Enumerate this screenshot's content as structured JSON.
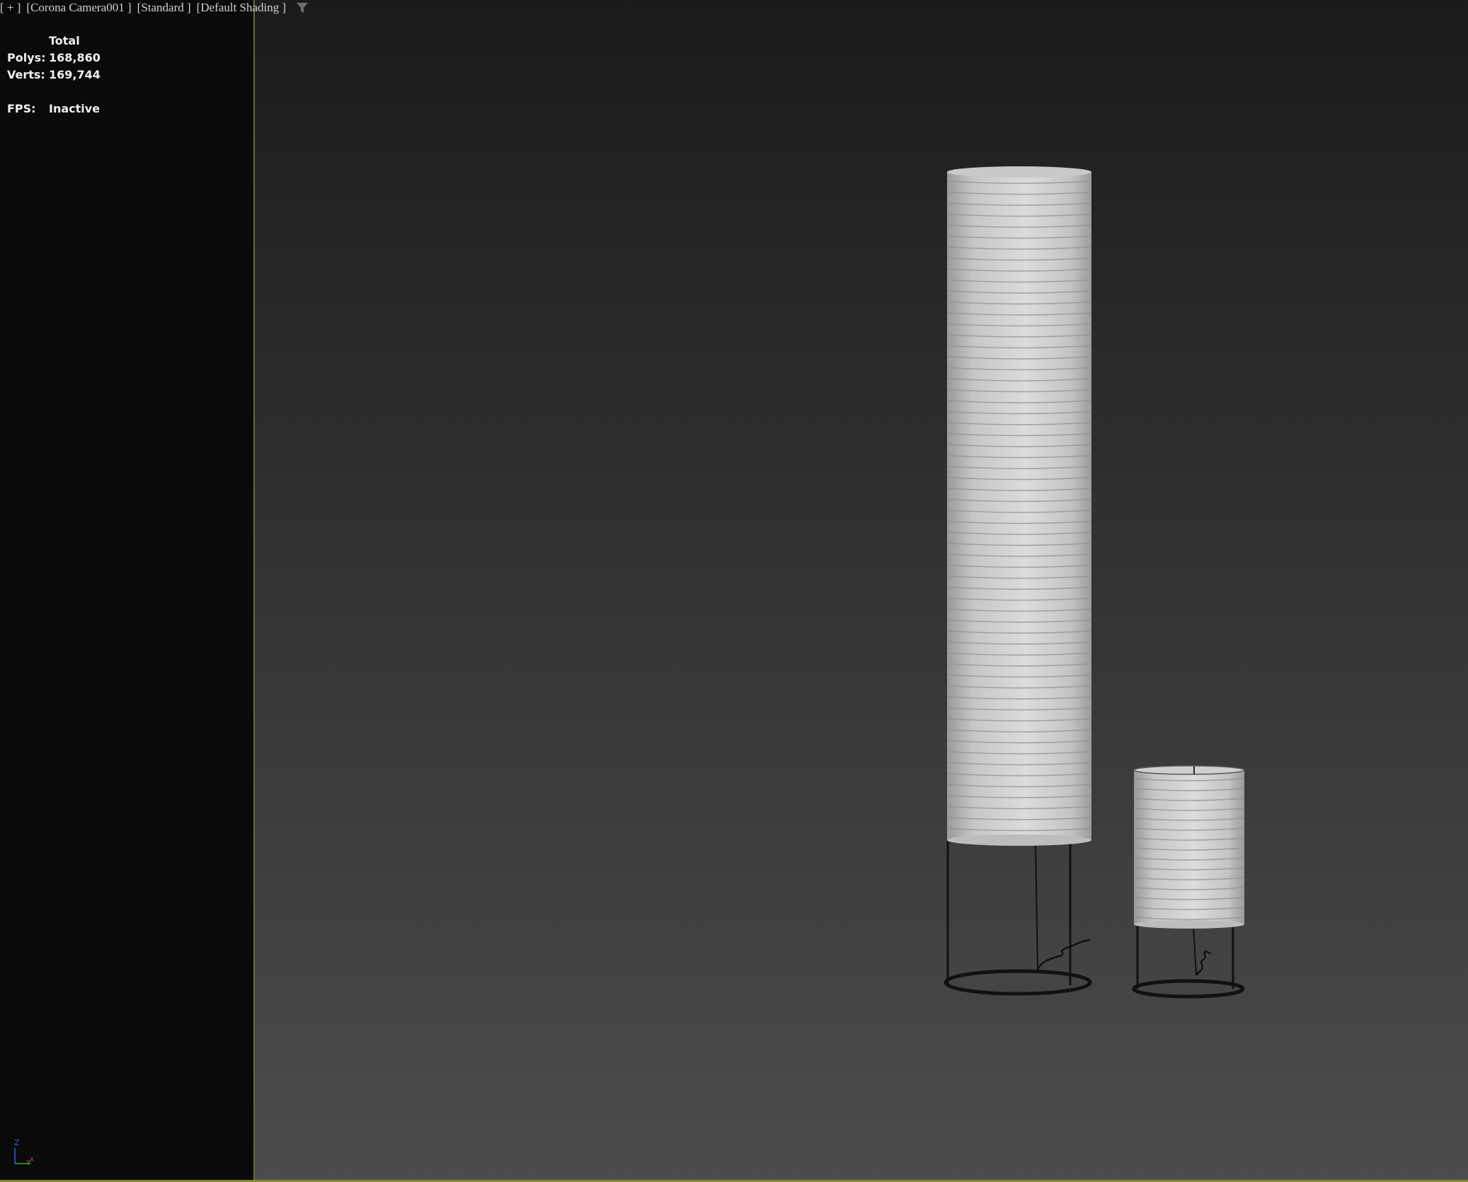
{
  "header": {
    "plus_menu": "[ + ]",
    "camera_menu": "[Corona Camera001 ]",
    "mode_menu": "[Standard ]",
    "shading_menu": "[Default Shading ]",
    "filter_icon": "funnel-icon"
  },
  "stats": {
    "total_label": "Total",
    "polys_label": "Polys:",
    "polys_value": "168,860",
    "verts_label": "Verts:",
    "verts_value": "169,744",
    "fps_label": "FPS:",
    "fps_value": "Inactive"
  },
  "gizmo": {
    "z_label": "Z",
    "y_label": "Y",
    "x_label": "X"
  },
  "colors": {
    "viewport_gradient_top": "#1b1b1b",
    "viewport_gradient_bottom": "#4c4c4c",
    "left_panel": "#0a0a0a",
    "divider": "#6e6a28",
    "shade_light": "#d6d6d6",
    "shade_dark": "#9a9a9a"
  }
}
